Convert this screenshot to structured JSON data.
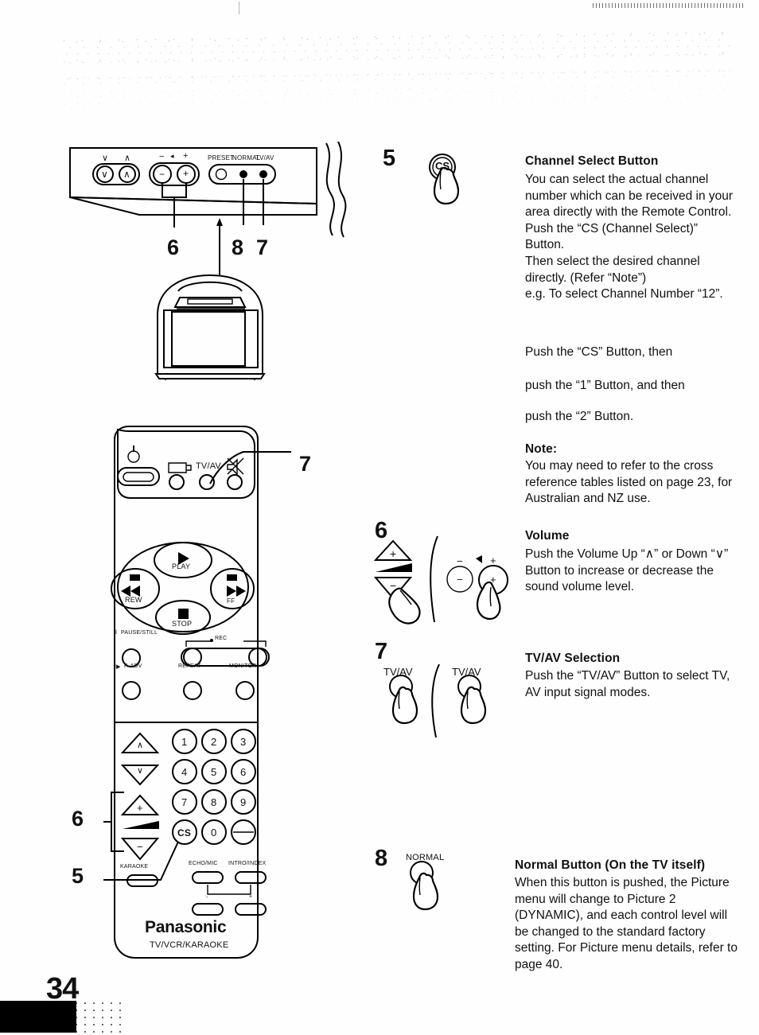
{
  "document": {
    "page_number": "34",
    "brand": "Panasonic",
    "product_line": "TV/VCR/KARAOKE"
  },
  "tv_panel": {
    "labels": {
      "ch_down": "∨",
      "ch_up": "∧",
      "vol_minus": "−",
      "vol_speaker": "◂",
      "vol_plus": "+",
      "preset": "PRESET",
      "normal": "NORMAL",
      "tv_av": "TV/AV"
    },
    "callouts": {
      "volume": "6",
      "normal": "8",
      "tv_av": "7"
    }
  },
  "remote": {
    "callouts": {
      "tv_av": "7",
      "volume": "6",
      "channel_select": "5"
    },
    "top_row": {
      "power": "power-icon",
      "plus_one": "+",
      "tv_av": "TV/AV",
      "mute": "mute-icon"
    },
    "transport": {
      "play": "PLAY",
      "rew": "REW",
      "ff": "FF",
      "stop": "STOP"
    },
    "vcr_row": {
      "pause_still": "PAUSE/STILL",
      "f_adv": "F. ADV",
      "rec": "REC",
      "repeat": "REPEAT",
      "monitor": "MONITOR"
    },
    "keypad": {
      "digits": [
        "1",
        "2",
        "3",
        "4",
        "5",
        "6",
        "7",
        "8",
        "9"
      ],
      "zero": "0",
      "cs": "CS",
      "dash": "-/--"
    },
    "bottom_labels": {
      "karaoke": "KARAOKE",
      "echo_mic": "ECHO/MIC",
      "intro_index": "INTRO/INDEX",
      "minus": "-",
      "plus": "+"
    },
    "vol_up": "+",
    "vol_down": "−",
    "ch_up": "∧",
    "ch_down": "∨"
  },
  "sections": [
    {
      "number": "5",
      "icon_label": "CS",
      "title": "Channel Select Button",
      "body": "You can select the actual channel number which can be received in your area directly with the Remote Control.\nPush the “CS (Channel Select)” Button.\nThen select the desired channel directly. (Refer “Note”)\ne.g. To select Channel Number “12”.",
      "steps": [
        "Push the “CS” Button, then",
        "push the “1” Button, and then",
        "push the “2” Button."
      ],
      "note_title": "Note:",
      "note_body": "You may need to refer to the cross reference tables listed on page 23, for Australian and NZ use."
    },
    {
      "number": "6",
      "title": "Volume",
      "body": "Push the Volume Up “∧” or Down “∨” Button to increase or decrease the sound volume level.",
      "remote_up": "+",
      "remote_down": "−",
      "tv_minus": "−",
      "tv_speaker": "◂",
      "tv_plus": "+"
    },
    {
      "number": "7",
      "title": "TV/AV Selection",
      "body": "Push the “TV/AV” Button to select TV, AV input signal modes.",
      "remote_button_label": "TV/AV",
      "tv_button_label": "TV/AV"
    },
    {
      "number": "8",
      "title": "Normal Button (On the TV itself)",
      "body": "When this button is pushed, the Picture menu will change to Picture 2 (DYNAMIC), and each control level will be changed to the standard factory setting. For Picture menu details, refer to page 40.",
      "button_label": "NORMAL"
    }
  ]
}
